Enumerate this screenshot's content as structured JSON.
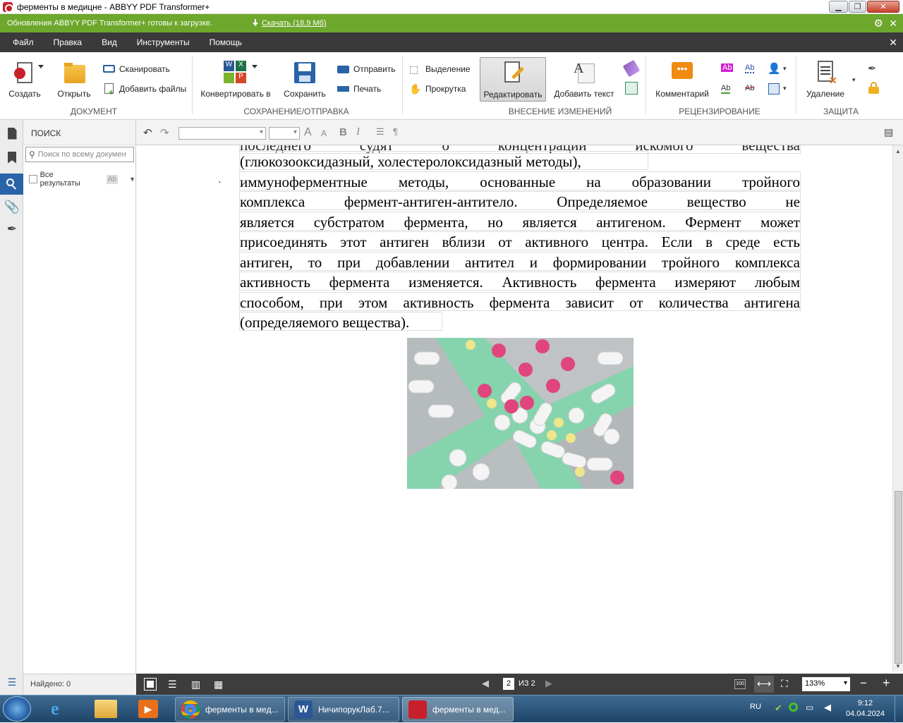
{
  "window": {
    "title": "ферменты в медицне - ABBYY PDF Transformer+"
  },
  "update": {
    "message": "Обновления ABBYY PDF Transformer+ готовы к загрузке.",
    "download": "Скачать (18,9 Мб)"
  },
  "menu": [
    "Файл",
    "Правка",
    "Вид",
    "Инструменты",
    "Помощь"
  ],
  "ribbon": {
    "create": "Создать",
    "open": "Открыть",
    "scan": "Сканировать",
    "add_files": "Добавить файлы",
    "convert": "Конвертировать в",
    "save": "Сохранить",
    "send": "Отправить",
    "print": "Печать",
    "select": "Выделение",
    "scroll": "Прокрутка",
    "edit": "Редактировать",
    "add_text": "Добавить текст",
    "comment": "Комментарий",
    "delete": "Удаление",
    "groups": {
      "document": "ДОКУМЕНТ",
      "save_send": "СОХРАНЕНИЕ/ОТПРАВКА",
      "changes": "ВНЕСЕНИЕ ИЗМЕНЕНИЙ",
      "review": "РЕЦЕНЗИРОВАНИЕ",
      "protect": "ЗАЩИТА"
    }
  },
  "search": {
    "title": "ПОИСК",
    "placeholder": "Поиск по всему докумен",
    "all_results": "Все результаты",
    "found": "Найдено: 0"
  },
  "document": {
    "lines": [
      "последнего судят о концентрации искомого вещества",
      "(глюкозооксидазный, холестеролоксидазный методы),",
      "иммуноферментные методы, основанные на образовании тройного",
      "комплекса фермент-антиген-антитело. Определяемое вещество не",
      "является субстратом фермента, но является антигеном. Фермент может",
      "присоединять этот антиген вблизи от активного центра. Если в среде есть",
      "антиген, то при добавлении антител и формировании тройного комплекса",
      "активность фермента изменяется. Активность фермента измеряют любым",
      "способом, при этом активность фермента зависит от количества антигена",
      "(определяемого вещества)."
    ],
    "bullet": "·"
  },
  "status": {
    "page": "2",
    "of": "ИЗ 2",
    "zoom": "133%"
  },
  "taskbar": {
    "items": [
      "ферменты в мед...",
      "НичипорукЛаб.7...",
      "ферменты в мед..."
    ],
    "lang": "RU",
    "time": "9:12",
    "date": "04.04.2024"
  },
  "colors": {
    "update_bar": "#6da72b",
    "menu_bar": "#3a3a3a",
    "accent_red": "#c8202b"
  }
}
